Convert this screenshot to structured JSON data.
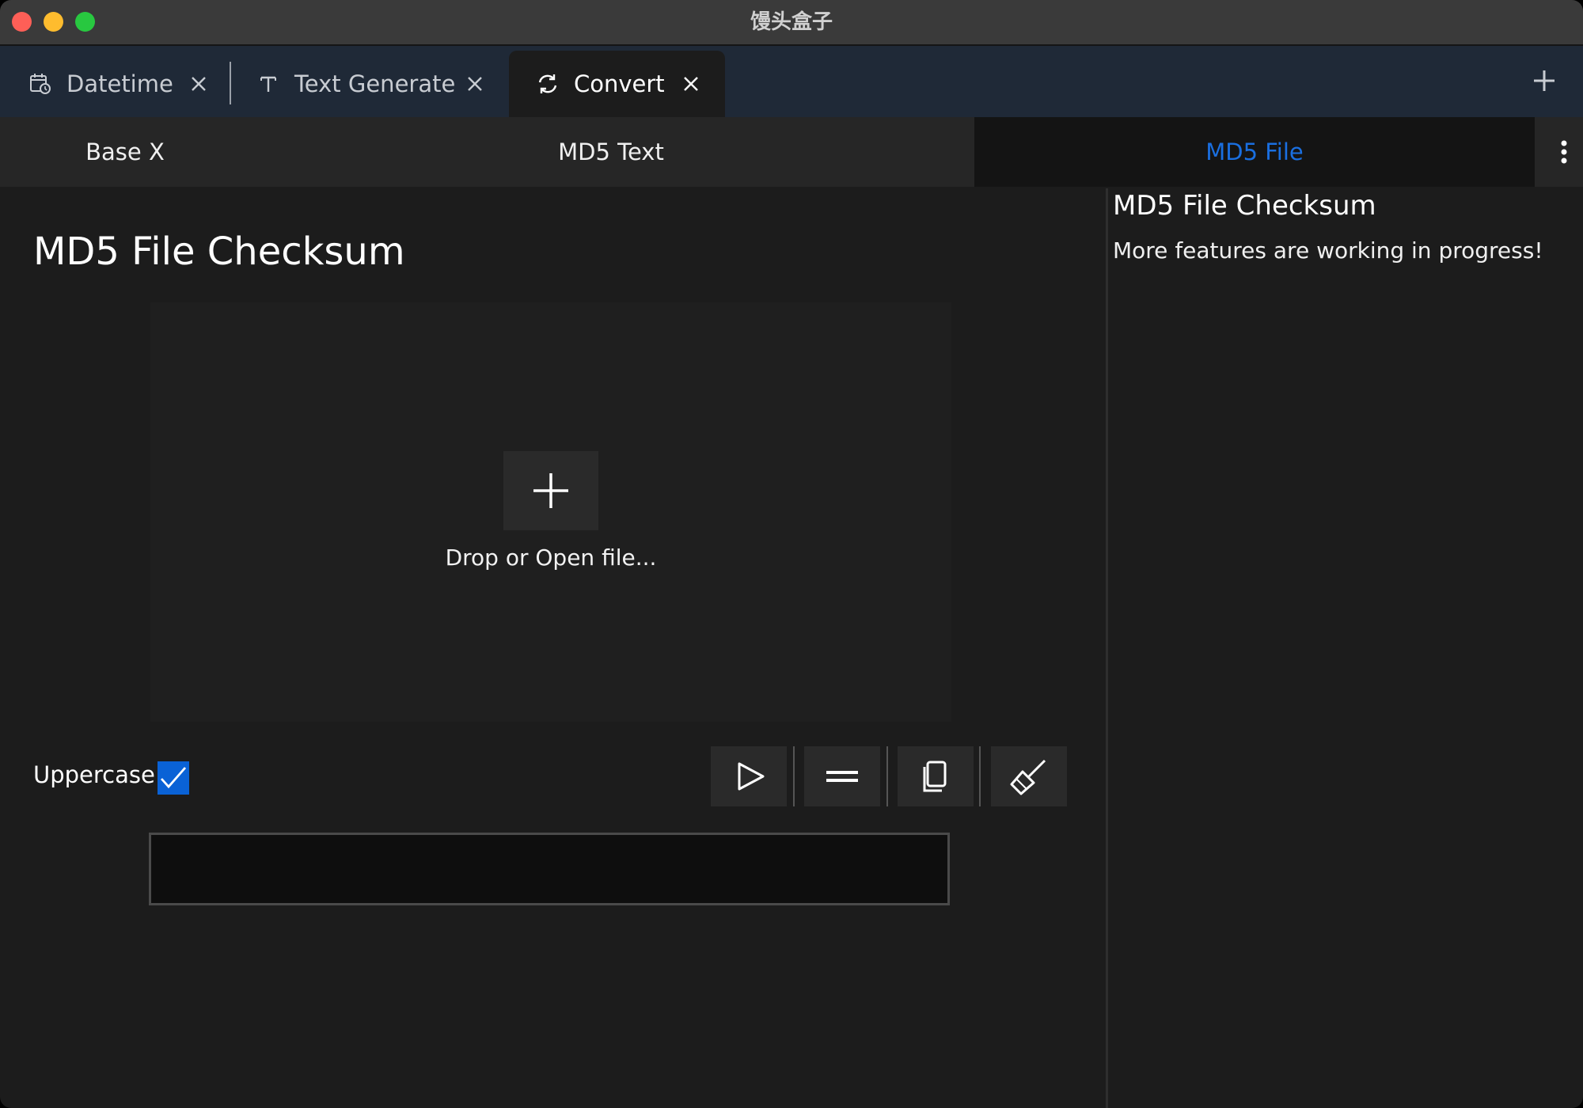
{
  "window": {
    "title": "馒头盒子"
  },
  "tabs": [
    {
      "label": "Datetime",
      "icon": "calendar-clock-icon"
    },
    {
      "label": "Text Generate",
      "icon": "text-icon"
    },
    {
      "label": "Convert",
      "icon": "refresh-icon",
      "active": true
    }
  ],
  "subtabs": {
    "items": [
      {
        "label": "Base X"
      },
      {
        "label": "MD5 Text"
      },
      {
        "label": "MD5 File",
        "active": true
      }
    ]
  },
  "main": {
    "title": "MD5 File Checksum",
    "dropzone": {
      "label": "Drop or Open file..."
    },
    "uppercase": {
      "label": "Uppercase:",
      "checked": true
    },
    "toolbar": [
      "run-icon",
      "equals-icon",
      "copy-icon",
      "clear-broom-icon"
    ],
    "output": {
      "value": ""
    }
  },
  "side": {
    "title": "MD5 File Checksum",
    "description": "More features are working in progress!"
  },
  "colors": {
    "accent": "#1a6fe0",
    "checkbox": "#0a62d6",
    "tabbar_bg": "#1f2937",
    "window_bg": "#1c1c1c"
  }
}
